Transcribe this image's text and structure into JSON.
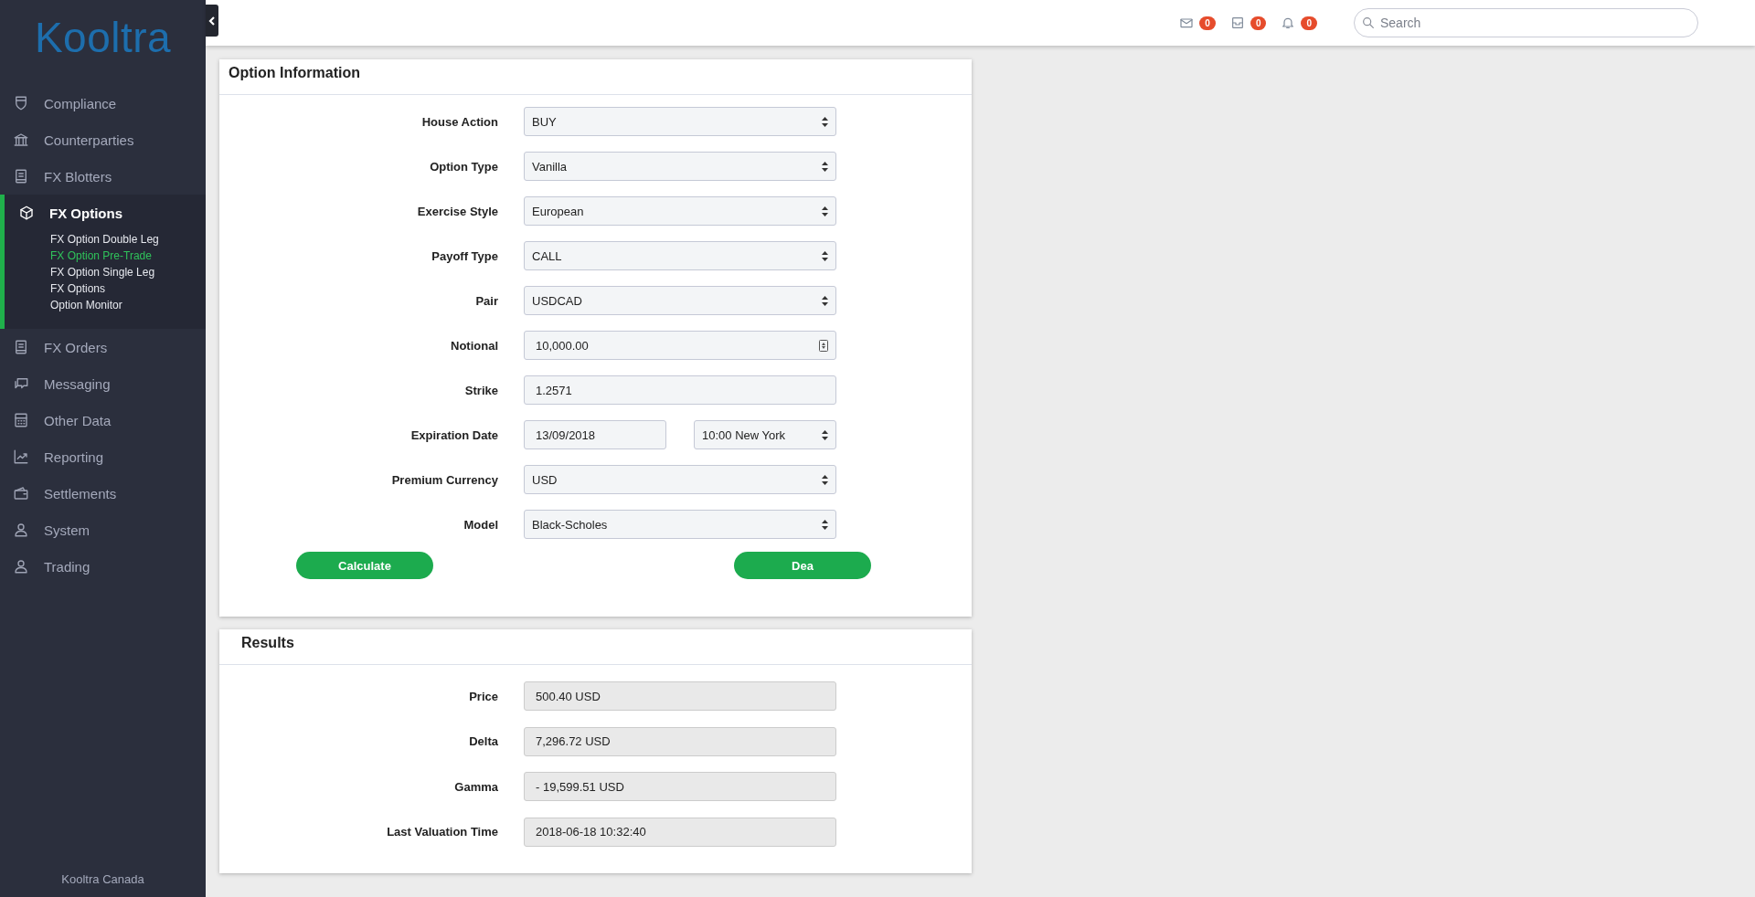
{
  "sidebar": {
    "logo": "Kooltra",
    "items": [
      {
        "label": "Compliance",
        "expanded": false
      },
      {
        "label": "Counterparties",
        "expanded": false
      },
      {
        "label": "FX Blotters",
        "expanded": false
      },
      {
        "label": "FX Options",
        "expanded": true,
        "children": [
          {
            "label": "FX Option Double Leg",
            "selected": false
          },
          {
            "label": "FX Option Pre-Trade",
            "selected": true
          },
          {
            "label": "FX Option Single Leg",
            "selected": false
          },
          {
            "label": "FX Options",
            "selected": false
          },
          {
            "label": "Option Monitor",
            "selected": false
          }
        ]
      },
      {
        "label": "FX Orders",
        "expanded": false
      },
      {
        "label": "Messaging",
        "expanded": false
      },
      {
        "label": "Other Data",
        "expanded": false
      },
      {
        "label": "Reporting",
        "expanded": false
      },
      {
        "label": "Settlements",
        "expanded": false
      },
      {
        "label": "System",
        "expanded": false
      },
      {
        "label": "Trading",
        "expanded": false
      }
    ],
    "footer": "Kooltra Canada"
  },
  "top_bar": {
    "counters": [
      {
        "kind": "mail",
        "count": "0"
      },
      {
        "kind": "inbox",
        "count": "0"
      },
      {
        "kind": "bell",
        "count": "0"
      }
    ],
    "search": {
      "placeholder": "Search"
    }
  },
  "option_information": {
    "title": "Option Information",
    "fields": [
      {
        "label": "House Action",
        "kind": "select",
        "value": "BUY"
      },
      {
        "label": "Option Type",
        "kind": "select",
        "value": "Vanilla"
      },
      {
        "label": "Exercise Style",
        "kind": "select",
        "value": "European"
      },
      {
        "label": "Payoff Type",
        "kind": "select",
        "value": "CALL"
      },
      {
        "label": "Pair",
        "kind": "select",
        "value": "USDCAD"
      },
      {
        "label": "Notional",
        "kind": "number",
        "value": "10,000.00"
      },
      {
        "label": "Strike",
        "kind": "text",
        "value": "1.2571"
      },
      {
        "label": "Expiration Date",
        "kind": "date-time",
        "value": "13/09/2018",
        "time": "10:00 New York"
      },
      {
        "label": "Premium Currency",
        "kind": "select",
        "value": "USD"
      },
      {
        "label": "Model",
        "kind": "select",
        "value": "Black-Scholes"
      }
    ],
    "buttons": [
      {
        "label": "Calculate"
      },
      {
        "label": "Dea"
      }
    ]
  },
  "results": {
    "title": "Results",
    "fields": [
      {
        "label": "Price",
        "value": "500.40 USD"
      },
      {
        "label": "Delta",
        "value": "7,296.72 USD"
      },
      {
        "label": "Gamma",
        "value": "- 19,599.51 USD"
      },
      {
        "label": "Last Valuation Time",
        "value": "2018-06-18 10:32:40"
      }
    ]
  }
}
